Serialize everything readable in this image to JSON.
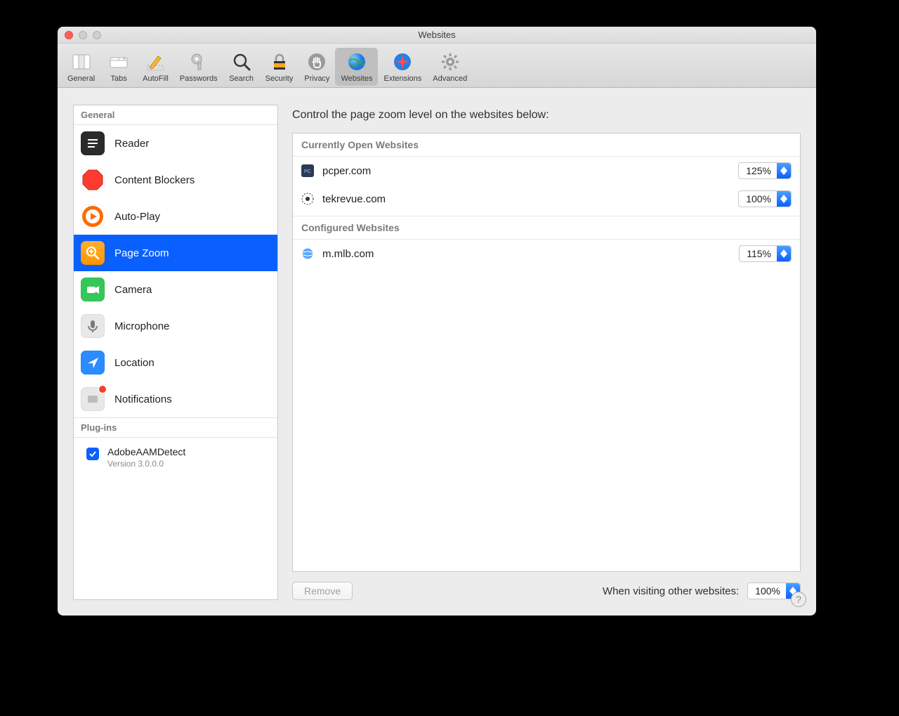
{
  "window": {
    "title": "Websites"
  },
  "toolbar": {
    "items": [
      {
        "label": "General"
      },
      {
        "label": "Tabs"
      },
      {
        "label": "AutoFill"
      },
      {
        "label": "Passwords"
      },
      {
        "label": "Search"
      },
      {
        "label": "Security"
      },
      {
        "label": "Privacy"
      },
      {
        "label": "Websites"
      },
      {
        "label": "Extensions"
      },
      {
        "label": "Advanced"
      }
    ],
    "selected_index": 7
  },
  "sidebar": {
    "section_general": "General",
    "section_plugins": "Plug-ins",
    "items": [
      {
        "label": "Reader"
      },
      {
        "label": "Content Blockers"
      },
      {
        "label": "Auto-Play"
      },
      {
        "label": "Page Zoom"
      },
      {
        "label": "Camera"
      },
      {
        "label": "Microphone"
      },
      {
        "label": "Location"
      },
      {
        "label": "Notifications"
      }
    ],
    "selected_index": 3,
    "plugin": {
      "name": "AdobeAAMDetect",
      "version": "Version 3.0.0.0",
      "checked": true
    }
  },
  "panel": {
    "title": "Control the page zoom level on the websites below:",
    "section_open": "Currently Open Websites",
    "section_configured": "Configured Websites",
    "open_sites": [
      {
        "domain": "pcper.com",
        "zoom": "125%"
      },
      {
        "domain": "tekrevue.com",
        "zoom": "100%"
      }
    ],
    "configured_sites": [
      {
        "domain": "m.mlb.com",
        "zoom": "115%"
      }
    ],
    "remove_label": "Remove",
    "footer_label": "When visiting other websites:",
    "footer_zoom": "100%"
  },
  "colors": {
    "accent": "#0a60ff"
  }
}
